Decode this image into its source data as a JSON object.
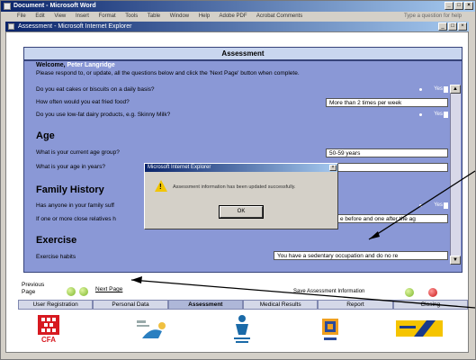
{
  "outer_window": {
    "title": "Document - Microsoft Word",
    "menu": [
      "File",
      "Edit",
      "View",
      "Insert",
      "Format",
      "Tools",
      "Table",
      "Window",
      "Help",
      "Adobe PDF",
      "Acrobat Comments"
    ],
    "menu_right": "Type a question for help"
  },
  "browser": {
    "title": "Assessment - Microsoft Internet Explorer"
  },
  "assessment": {
    "header": "Assessment",
    "welcome_label": "Welcome,",
    "user_name": "Peter Langridge",
    "instructions": "Please respond to, or update, all the questions below and click the 'Next Page' button when complete.",
    "questions_diet": [
      {
        "text": "Do you eat cakes or biscuits on a daily basis?",
        "answer": "Yes"
      },
      {
        "text": "How often would you eat fried food?",
        "answer": "More than 2 times per week"
      },
      {
        "text": "Do you use low-fat dairy products, e.g. Skinny Milk?",
        "answer": "Yes"
      }
    ],
    "section_age": "Age",
    "questions_age": [
      {
        "text": "What is your current age group?",
        "answer": "50-59 years"
      },
      {
        "text": "What is your age in years?",
        "answer": ""
      }
    ],
    "section_family": "Family History",
    "questions_family": [
      {
        "text": "Has anyone in your family suff",
        "answer": "Yes"
      },
      {
        "text": "If one or more close relatives h",
        "answer": "e before and one after the ag"
      }
    ],
    "section_exercise": "Exercise",
    "questions_exercise": [
      {
        "text": "Exercise habits",
        "answer": "You have a sedentary occupation and do no re"
      }
    ]
  },
  "dialog": {
    "title": "Microsoft Internet Explorer",
    "message": "Assessment information has been updated successfully.",
    "ok_label": "OK"
  },
  "nav": {
    "previous_page": "Previous Page",
    "next_page": "Next Page",
    "save_assessment": "Save Assessment Information"
  },
  "tabs": [
    {
      "label": "User Registration",
      "active": false
    },
    {
      "label": "Personal Data",
      "active": false
    },
    {
      "label": "Assessment",
      "active": true
    },
    {
      "label": "Medical Results",
      "active": false
    },
    {
      "label": "Report",
      "active": false
    },
    {
      "label": "Closing",
      "active": false
    }
  ],
  "logos": [
    {
      "name": "cfa-logo",
      "text": "CFA"
    },
    {
      "name": "partner-logo-2",
      "text": ""
    },
    {
      "name": "partner-logo-3",
      "text": ""
    },
    {
      "name": "partner-logo-4",
      "text": ""
    },
    {
      "name": "partner-logo-5",
      "text": ""
    }
  ],
  "colors": {
    "panel": "#8a98d6",
    "header": "#c9d6ef",
    "title_bar": "#0a246a",
    "warning": "#f2c500"
  }
}
